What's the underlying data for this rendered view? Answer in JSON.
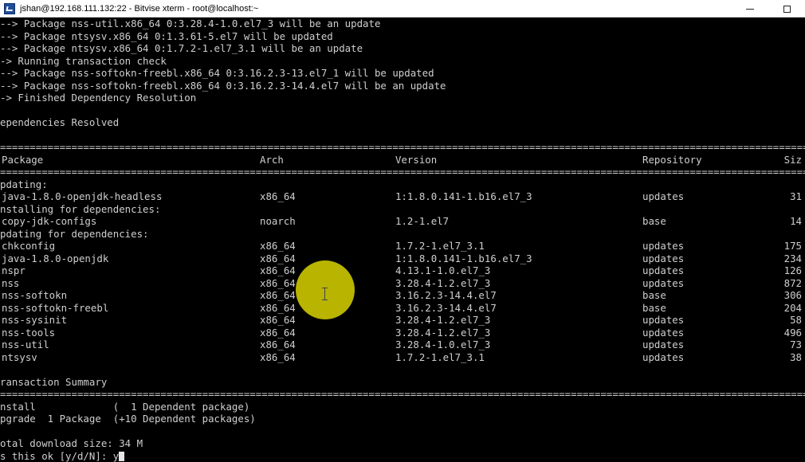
{
  "window": {
    "title": "jshan@192.168.111.132:22 - Bitvise xterm - root@localhost:~",
    "app_icon": "bitvise-terminal-icon",
    "controls": [
      "minimize-icon",
      "maximize-icon"
    ]
  },
  "terminal": {
    "pre_lines": [
      "--> Package nss-util.x86_64 0:3.28.4-1.0.el7_3 will be an update",
      "--> Package ntsysv.x86_64 0:1.3.61-5.el7 will be updated",
      "--> Package ntsysv.x86_64 0:1.7.2-1.el7_3.1 will be an update",
      "-> Running transaction check",
      "--> Package nss-softokn-freebl.x86_64 0:3.16.2.3-13.el7_1 will be updated",
      "--> Package nss-softokn-freebl.x86_64 0:3.16.2.3-14.4.el7 will be an update",
      "-> Finished Dependency Resolution",
      "",
      "ependencies Resolved",
      ""
    ],
    "separator": "=====================================================================================================================================================",
    "table": {
      "headers": {
        "package": "Package",
        "arch": "Arch",
        "version": "Version",
        "repository": "Repository",
        "size": "Siz"
      },
      "sections": [
        {
          "label": "pdating:",
          "rows": [
            {
              "package": "java-1.8.0-openjdk-headless",
              "arch": "x86_64",
              "version": "1:1.8.0.141-1.b16.el7_3",
              "repository": "updates",
              "size": "31"
            }
          ]
        },
        {
          "label": "nstalling for dependencies:",
          "rows": [
            {
              "package": "copy-jdk-configs",
              "arch": "noarch",
              "version": "1.2-1.el7",
              "repository": "base",
              "size": "14"
            }
          ]
        },
        {
          "label": "pdating for dependencies:",
          "rows": [
            {
              "package": "chkconfig",
              "arch": "x86_64",
              "version": "1.7.2-1.el7_3.1",
              "repository": "updates",
              "size": "175"
            },
            {
              "package": "java-1.8.0-openjdk",
              "arch": "x86_64",
              "version": "1:1.8.0.141-1.b16.el7_3",
              "repository": "updates",
              "size": "234"
            },
            {
              "package": "nspr",
              "arch": "x86_64",
              "version": "4.13.1-1.0.el7_3",
              "repository": "updates",
              "size": "126"
            },
            {
              "package": "nss",
              "arch": "x86_64",
              "version": "3.28.4-1.2.el7_3",
              "repository": "updates",
              "size": "872"
            },
            {
              "package": "nss-softokn",
              "arch": "x86_64",
              "version": "3.16.2.3-14.4.el7",
              "repository": "base",
              "size": "306"
            },
            {
              "package": "nss-softokn-freebl",
              "arch": "x86_64",
              "version": "3.16.2.3-14.4.el7",
              "repository": "base",
              "size": "204"
            },
            {
              "package": "nss-sysinit",
              "arch": "x86_64",
              "version": "3.28.4-1.2.el7_3",
              "repository": "updates",
              "size": "58"
            },
            {
              "package": "nss-tools",
              "arch": "x86_64",
              "version": "3.28.4-1.2.el7_3",
              "repository": "updates",
              "size": "496"
            },
            {
              "package": "nss-util",
              "arch": "x86_64",
              "version": "3.28.4-1.0.el7_3",
              "repository": "updates",
              "size": "73"
            },
            {
              "package": "ntsysv",
              "arch": "x86_64",
              "version": "1.7.2-1.el7_3.1",
              "repository": "updates",
              "size": "38"
            }
          ]
        }
      ]
    },
    "summary": {
      "title": "ransaction Summary",
      "install_line": "nstall             (  1 Dependent package)",
      "upgrade_line": "pgrade  1 Package  (+10 Dependent packages)",
      "download_size": "otal download size: 34 M",
      "prompt": "s this ok [y/d/N]: y"
    },
    "colors": {
      "background": "#000000",
      "text": "#cfcfcf",
      "mouse_highlight": "#d2cd00"
    }
  }
}
